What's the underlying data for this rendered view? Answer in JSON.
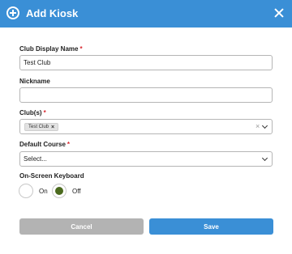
{
  "header": {
    "title": "Add Kiosk",
    "bg_color": "#3a8fd6",
    "icon": "plus-circle-icon",
    "close_icon": "close-icon"
  },
  "form": {
    "club_display_name": {
      "label": "Club Display Name",
      "required_mark": "*",
      "value": "Test Club"
    },
    "nickname": {
      "label": "Nickname",
      "value": ""
    },
    "clubs": {
      "label": "Club(s)",
      "required_mark": "*",
      "chips": [
        {
          "label": "Test Club",
          "remove": "×"
        }
      ],
      "clear": "×"
    },
    "default_course": {
      "label": "Default Course",
      "required_mark": "*",
      "value": "Select..."
    },
    "on_screen_keyboard": {
      "label": "On-Screen Keyboard",
      "options": [
        {
          "label": "On",
          "selected": false
        },
        {
          "label": "Off",
          "selected": true
        }
      ],
      "selected_color": "#4b6a1e"
    }
  },
  "actions": {
    "cancel_label": "Cancel",
    "save_label": "Save",
    "cancel_color": "#b3b3b3",
    "save_color": "#3a8fd6"
  }
}
